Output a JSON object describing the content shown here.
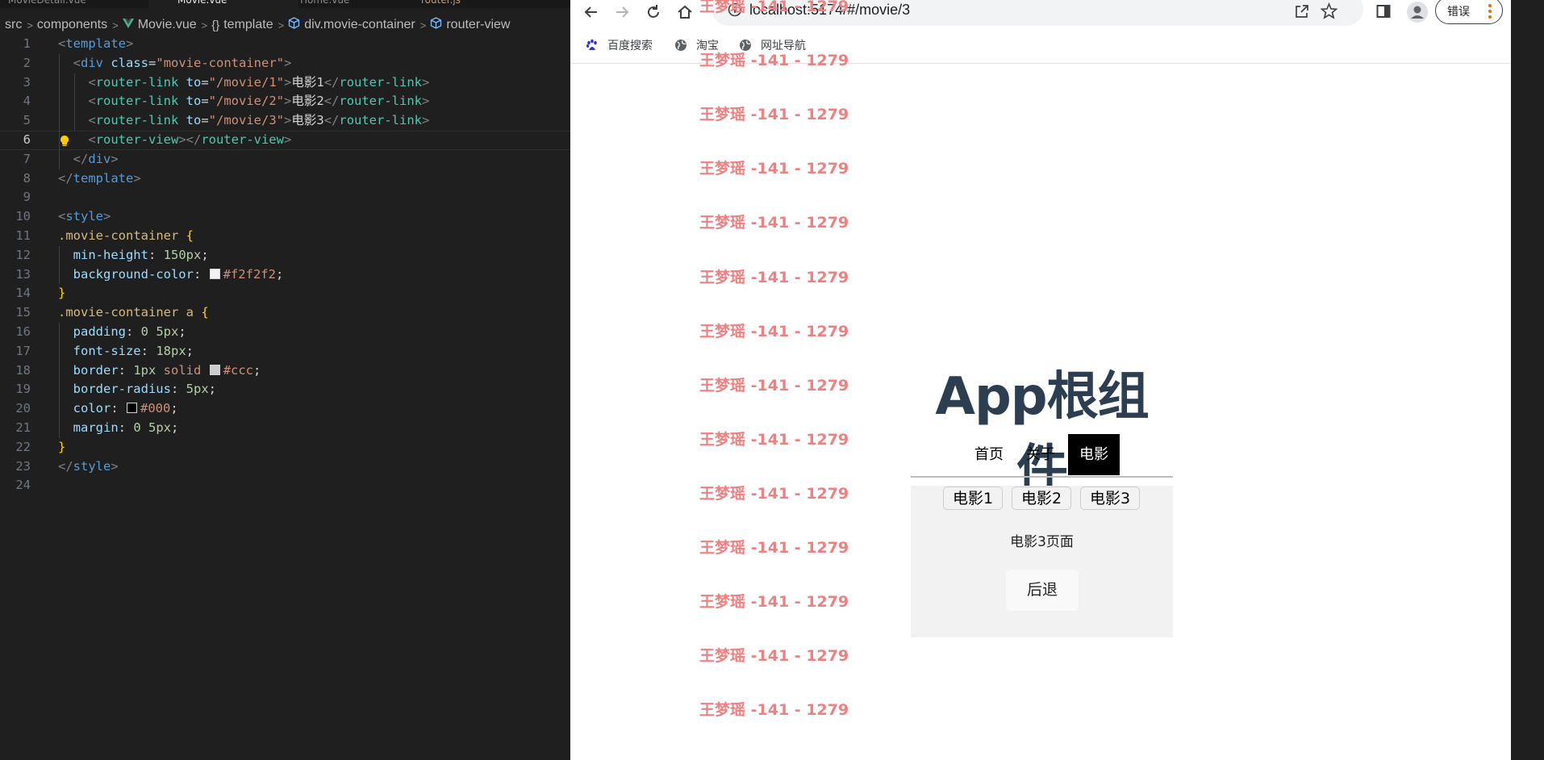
{
  "editor": {
    "tabs": [
      "MovieDetail.vue",
      "Movie.vue",
      "Home.vue",
      "router.js"
    ],
    "breadcrumb": [
      "src",
      "components",
      "Movie.vue",
      "template",
      "div.movie-container",
      "router-view"
    ],
    "breadcrumb_icons": [
      "vue-icon",
      "braces-icon",
      "cube-icon",
      "cube-icon"
    ],
    "colors": {
      "vue": "#41b883",
      "swatch_f2": "#f2f2f2",
      "swatch_ccc": "#cccccc",
      "swatch_000": "#000000"
    },
    "lines": [
      {
        "n": "1",
        "tokens": [
          [
            "br",
            "<"
          ],
          [
            "tag",
            "template"
          ],
          [
            "br",
            ">"
          ]
        ]
      },
      {
        "n": "2",
        "tokens": [
          [
            "br",
            "<"
          ],
          [
            "tag",
            "div"
          ],
          [
            "txt",
            " "
          ],
          [
            "attr",
            "class"
          ],
          [
            "txt",
            "="
          ],
          [
            "str",
            "\"movie-container\""
          ],
          [
            "br",
            ">"
          ]
        ]
      },
      {
        "n": "3",
        "tokens": [
          [
            "br",
            "<"
          ],
          [
            "tagc",
            "router-link"
          ],
          [
            "txt",
            " "
          ],
          [
            "attr",
            "to"
          ],
          [
            "txt",
            "="
          ],
          [
            "str",
            "\"/movie/1\""
          ],
          [
            "br",
            ">"
          ],
          [
            "txt",
            "电影1"
          ],
          [
            "br",
            "</"
          ],
          [
            "tagc",
            "router-link"
          ],
          [
            "br",
            ">"
          ]
        ]
      },
      {
        "n": "4",
        "tokens": [
          [
            "br",
            "<"
          ],
          [
            "tagc",
            "router-link"
          ],
          [
            "txt",
            " "
          ],
          [
            "attr",
            "to"
          ],
          [
            "txt",
            "="
          ],
          [
            "str",
            "\"/movie/2\""
          ],
          [
            "br",
            ">"
          ],
          [
            "txt",
            "电影2"
          ],
          [
            "br",
            "</"
          ],
          [
            "tagc",
            "router-link"
          ],
          [
            "br",
            ">"
          ]
        ]
      },
      {
        "n": "5",
        "tokens": [
          [
            "br",
            "<"
          ],
          [
            "tagc",
            "router-link"
          ],
          [
            "txt",
            " "
          ],
          [
            "attr",
            "to"
          ],
          [
            "txt",
            "="
          ],
          [
            "str",
            "\"/movie/3\""
          ],
          [
            "br",
            ">"
          ],
          [
            "txt",
            "电影3"
          ],
          [
            "br",
            "</"
          ],
          [
            "tagc",
            "router-link"
          ],
          [
            "br",
            ">"
          ]
        ]
      },
      {
        "n": "6",
        "tokens": [
          [
            "br",
            "<"
          ],
          [
            "tagc",
            "router-view"
          ],
          [
            "br",
            "></"
          ],
          [
            "tagc",
            "router-view"
          ],
          [
            "br",
            ">"
          ]
        ]
      },
      {
        "n": "7",
        "tokens": [
          [
            "br",
            "</"
          ],
          [
            "tag",
            "div"
          ],
          [
            "br",
            ">"
          ]
        ]
      },
      {
        "n": "8",
        "tokens": [
          [
            "br",
            "</"
          ],
          [
            "tag",
            "template"
          ],
          [
            "br",
            ">"
          ]
        ]
      },
      {
        "n": "9",
        "tokens": []
      },
      {
        "n": "10",
        "tokens": [
          [
            "br",
            "<"
          ],
          [
            "tag",
            "style"
          ],
          [
            "br",
            ">"
          ]
        ]
      },
      {
        "n": "11",
        "tokens": [
          [
            "sel",
            ".movie-container"
          ],
          [
            "txt",
            " "
          ],
          [
            "brace",
            "{"
          ]
        ]
      },
      {
        "n": "12",
        "tokens": [
          [
            "prop",
            "min-height"
          ],
          [
            "pun",
            ": "
          ],
          [
            "num",
            "150px"
          ],
          [
            "pun",
            ";"
          ]
        ]
      },
      {
        "n": "13",
        "tokens": [
          [
            "prop",
            "background-color"
          ],
          [
            "pun",
            ": "
          ],
          [
            "sw",
            "#f2f2f2"
          ],
          [
            "val",
            "#f2f2f2"
          ],
          [
            "pun",
            ";"
          ]
        ]
      },
      {
        "n": "14",
        "tokens": [
          [
            "brace",
            "}"
          ]
        ]
      },
      {
        "n": "15",
        "tokens": [
          [
            "sel",
            ".movie-container a"
          ],
          [
            "txt",
            " "
          ],
          [
            "brace",
            "{"
          ]
        ]
      },
      {
        "n": "16",
        "tokens": [
          [
            "prop",
            "padding"
          ],
          [
            "pun",
            ": "
          ],
          [
            "num",
            "0 5px"
          ],
          [
            "pun",
            ";"
          ]
        ]
      },
      {
        "n": "17",
        "tokens": [
          [
            "prop",
            "font-size"
          ],
          [
            "pun",
            ": "
          ],
          [
            "num",
            "18px"
          ],
          [
            "pun",
            ";"
          ]
        ]
      },
      {
        "n": "18",
        "tokens": [
          [
            "prop",
            "border"
          ],
          [
            "pun",
            ": "
          ],
          [
            "num",
            "1px"
          ],
          [
            "txt",
            " "
          ],
          [
            "val",
            "solid"
          ],
          [
            "txt",
            " "
          ],
          [
            "sw",
            "#cccccc"
          ],
          [
            "val",
            "#ccc"
          ],
          [
            "pun",
            ";"
          ]
        ]
      },
      {
        "n": "19",
        "tokens": [
          [
            "prop",
            "border-radius"
          ],
          [
            "pun",
            ": "
          ],
          [
            "num",
            "5px"
          ],
          [
            "pun",
            ";"
          ]
        ]
      },
      {
        "n": "20",
        "tokens": [
          [
            "prop",
            "color"
          ],
          [
            "pun",
            ": "
          ],
          [
            "sw",
            "#000000"
          ],
          [
            "val",
            "#000"
          ],
          [
            "pun",
            ";"
          ]
        ]
      },
      {
        "n": "21",
        "tokens": [
          [
            "prop",
            "margin"
          ],
          [
            "pun",
            ": "
          ],
          [
            "num",
            "0 5px"
          ],
          [
            "pun",
            ";"
          ]
        ]
      },
      {
        "n": "22",
        "tokens": [
          [
            "brace",
            "}"
          ]
        ]
      },
      {
        "n": "23",
        "tokens": [
          [
            "br",
            "</"
          ],
          [
            "tag",
            "style"
          ],
          [
            "br",
            ">"
          ]
        ]
      },
      {
        "n": "24",
        "tokens": []
      }
    ]
  },
  "browser": {
    "url": "localhost:5174/#/movie/3",
    "error_button": "错误",
    "bookmarks": [
      {
        "label": "百度搜索",
        "icon": "baidu-paw-icon"
      },
      {
        "label": "淘宝",
        "icon": "globe-icon"
      },
      {
        "label": "网址导航",
        "icon": "globe-icon"
      }
    ],
    "icons": {
      "back": "back-arrow-icon",
      "forward": "forward-arrow-icon",
      "reload": "reload-icon",
      "home": "home-icon",
      "share": "share-icon",
      "star": "star-icon",
      "sidepanel": "side-panel-icon",
      "profile": "profile-icon",
      "menu": "kebab-menu-icon"
    },
    "watermark": "王梦瑶 -141 - 1279",
    "app": {
      "title": "App根组件",
      "nav": [
        "首页",
        "关于",
        "电影"
      ],
      "active_nav": "电影",
      "movie_links": [
        "电影1",
        "电影2",
        "电影3"
      ],
      "page_text": "电影3页面",
      "back_button": "后退"
    }
  }
}
